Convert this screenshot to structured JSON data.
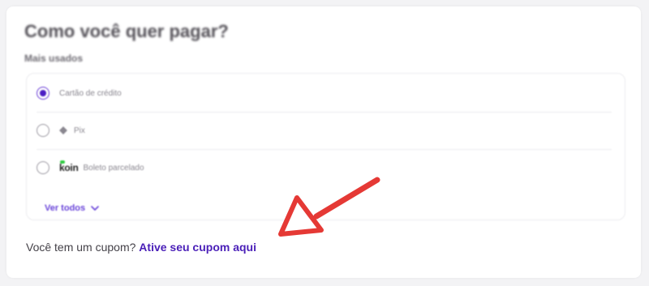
{
  "payment": {
    "title": "Como você quer pagar?",
    "section_label": "Mais usados",
    "options": [
      {
        "label": "Cartão de crédito",
        "selected": true
      },
      {
        "label": "Pix",
        "icon": "pix-icon",
        "selected": false
      },
      {
        "label": "Boleto parcelado",
        "brand": "koin",
        "selected": false
      }
    ],
    "see_all_label": "Ver todos"
  },
  "coupon": {
    "prompt": "Você tem um cupom?",
    "link_label": "Ative seu cupom aqui"
  },
  "colors": {
    "accent": "#4a1fb8",
    "annotation_arrow": "#e53935"
  }
}
